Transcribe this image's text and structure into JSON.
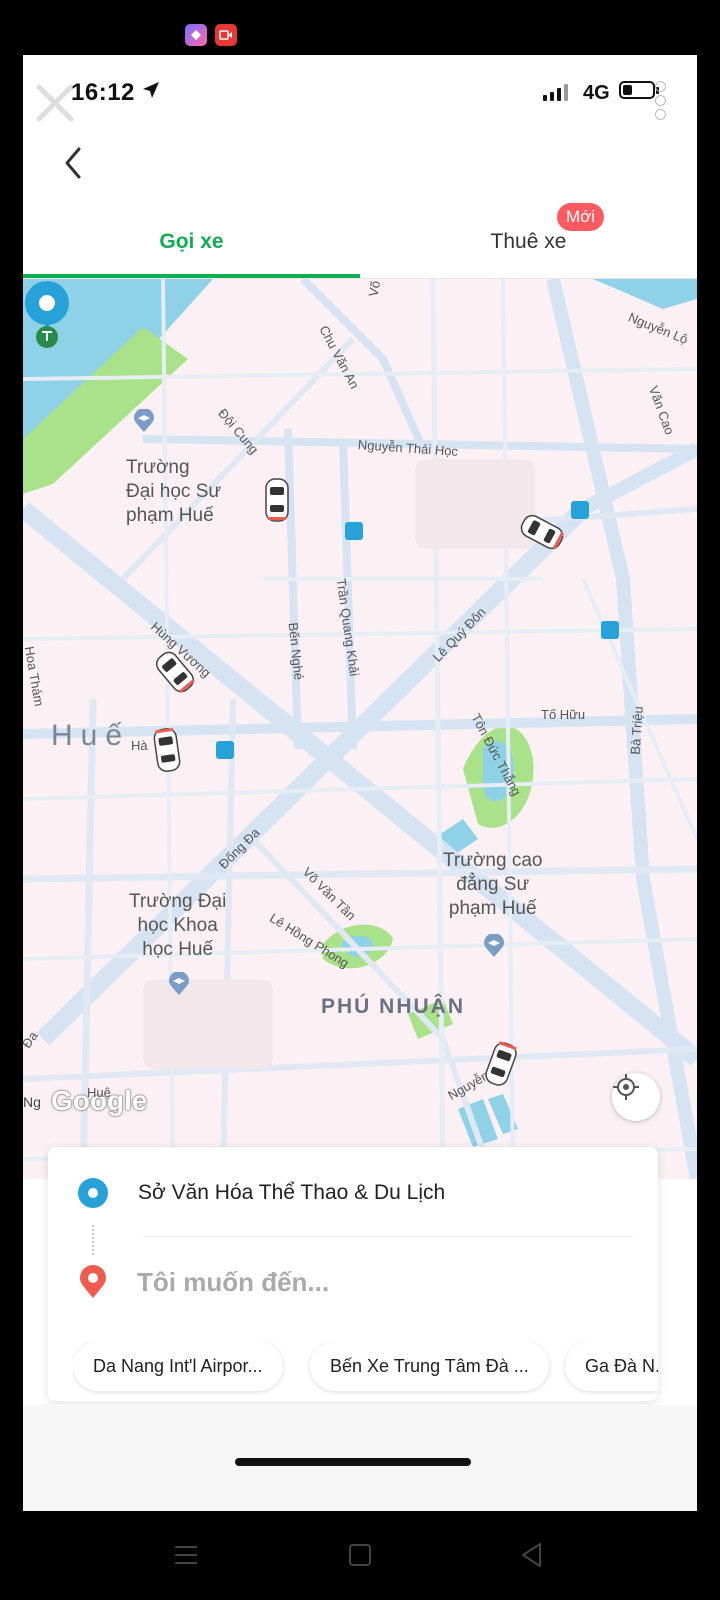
{
  "status_bar": {
    "time": "16:12",
    "network": "4G"
  },
  "tabs": [
    {
      "label": "Gọi xe",
      "active": true
    },
    {
      "label": "Thuê xe",
      "active": false
    }
  ],
  "badge": {
    "label": "Mới"
  },
  "map": {
    "city": "Huế",
    "district": "PHÚ NHUẬN",
    "attribution": "Google",
    "places": {
      "p1": "Trường\nĐại học Sư\nphạm Huế",
      "p2": "Trường Đại\nhọc Khoa\nhọc Huế",
      "p3": "Trường cao\nđẳng Sư\nphạm Huế"
    },
    "streets": {
      "s1": "Chu Văn An",
      "s2": "Võ Thị Sáu",
      "s3": "Nguyễn Thái Học",
      "s4": "Đội Cung",
      "s5": "Trần Quang Khải",
      "s6": "Bến Nghé",
      "s7": "Hùng Vương",
      "s8": "Lê Quý Đôn",
      "s9": "Tôn Đức Thắng",
      "s10": "Tố Hữu",
      "s11": "Bà Triệu",
      "s12": "Đống Đa",
      "s13": "Võ Văn Tần",
      "s14": "Lê Hồng Phong",
      "s15": "Nguyễn Huệ",
      "s16": "Văn Cao",
      "s17": "Nguyễn Lộ",
      "s18": "Hà",
      "s19": "Hoa Thám",
      "s20": "Đa",
      "s21": "Ng",
      "s22": "Huệ"
    }
  },
  "trip": {
    "origin": "Sở Văn Hóa Thể Thao & Du Lịch",
    "destination_placeholder": "Tôi muốn đến..."
  },
  "suggestions": [
    "Da Nang Int'l Airpor...",
    "Bến Xe Trung Tâm Đà ...",
    "Ga Đà N..."
  ],
  "colors": {
    "accent": "#0fae52",
    "origin": "#27a2d9",
    "destination": "#ef5b4d",
    "badge": "#ff5a5f",
    "water": "#8fd1e6",
    "park": "#a9e28a"
  }
}
